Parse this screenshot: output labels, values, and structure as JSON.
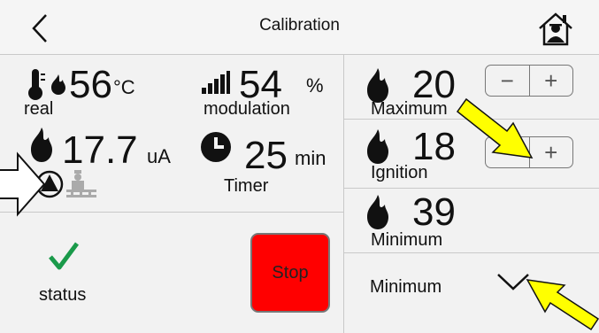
{
  "header": {
    "title": "Calibration"
  },
  "left": {
    "temperature": {
      "value": "56",
      "unit": "°C",
      "label": "real"
    },
    "modulation": {
      "value": "54",
      "unit": "%",
      "label": "modulation"
    },
    "flame_current": {
      "value": "17.7",
      "unit": "uA"
    },
    "timer": {
      "value": "25",
      "unit": "min",
      "label": "Timer"
    },
    "status": {
      "label": "status"
    },
    "stop_button": {
      "label": "Stop"
    }
  },
  "right": {
    "maximum": {
      "value": "20",
      "label": "Maximum",
      "minus": "−",
      "plus": "+"
    },
    "ignition": {
      "value": "18",
      "label": "Ignition",
      "minus": "−",
      "plus": "+"
    },
    "minimum": {
      "value": "39",
      "label": "Minimum"
    },
    "dropdown": {
      "label": "Minimum"
    }
  },
  "colors": {
    "stop": "#ff0000",
    "check": "#1a9a4a",
    "arrow": "#ffff00"
  }
}
